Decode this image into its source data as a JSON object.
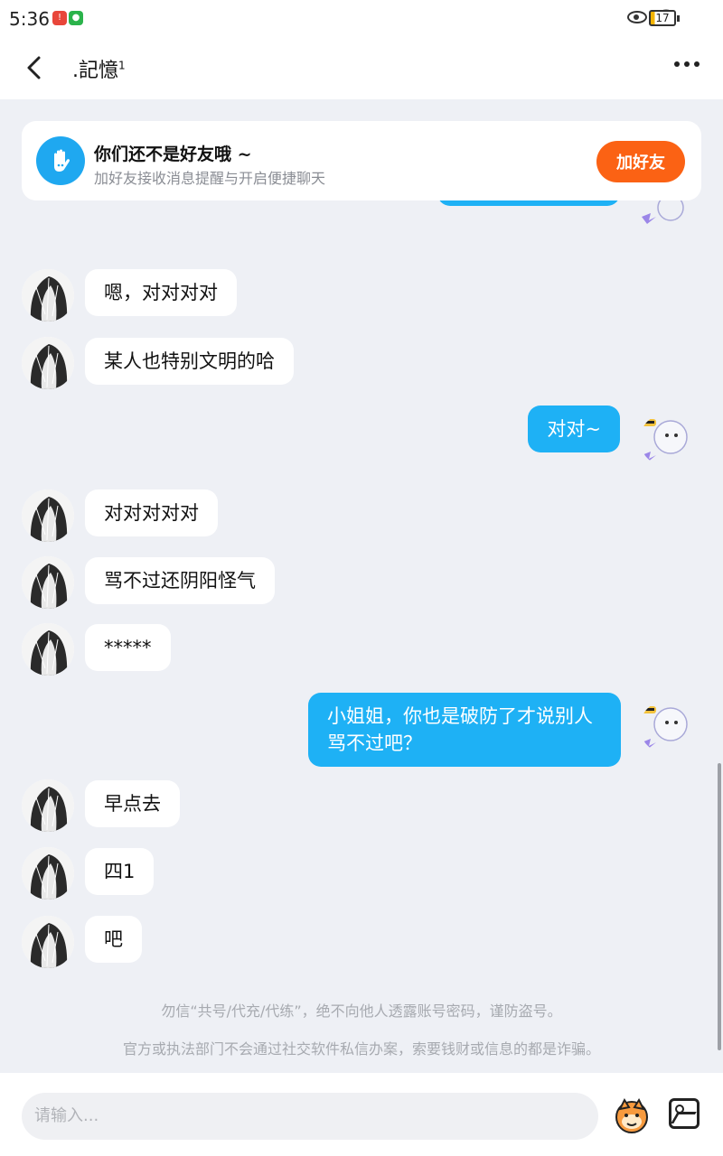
{
  "status_bar": {
    "time": "5:36",
    "battery": "17",
    "icons": [
      "notification-red-icon",
      "wechat-icon",
      "eye-icon",
      "wifi-icon",
      "battery-icon"
    ]
  },
  "header": {
    "title": ".記憶",
    "title_sup": "1",
    "back_icon": "back-arrow-icon",
    "more_icon": "more-dots-icon"
  },
  "friend_banner": {
    "title": "你们还不是好友哦 ~",
    "subtitle": "加好友接收消息提醒与开启便捷聊天",
    "button_label": "加好友",
    "icon": "hand-icon"
  },
  "messages": [
    {
      "side": "in",
      "text": "嗯，对对对对"
    },
    {
      "side": "in",
      "text": "某人也特别文明的哈"
    },
    {
      "side": "out",
      "text": "对对~"
    },
    {
      "side": "in",
      "text": "对对对对对"
    },
    {
      "side": "in",
      "text": "骂不过还阴阳怪气"
    },
    {
      "side": "in",
      "text": "*****"
    },
    {
      "side": "out",
      "text": "小姐姐，你也是破防了才说别人骂不过吧？"
    },
    {
      "side": "in",
      "text": "早点去"
    },
    {
      "side": "in",
      "text": "四1"
    },
    {
      "side": "in",
      "text": "吧"
    }
  ],
  "warnings": [
    "勿信“共号/代充/代练”，绝不向他人透露账号密码，谨防盗号。",
    "官方或执法部门不会通过社交软件私信办案，索要钱财或信息的都是诈骗。"
  ],
  "input_bar": {
    "placeholder": "请输入...",
    "emoji_icon": "emoji-icon",
    "image_icon": "image-icon"
  },
  "colors": {
    "accent_blue": "#1eb1f5",
    "add_friend_orange": "#fb6214",
    "background": "#eef0f5"
  }
}
